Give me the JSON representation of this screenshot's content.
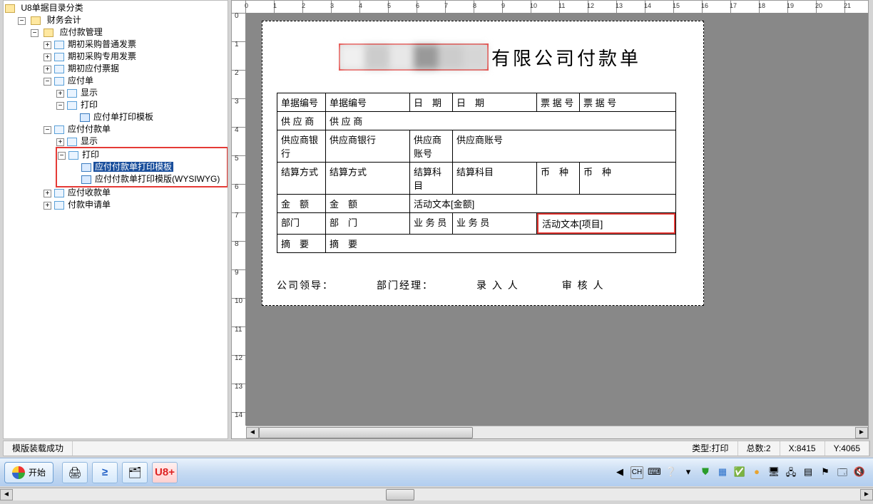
{
  "tree": {
    "root": "U8单据目录分类",
    "n_1": "财务会计",
    "n_1_1": "应付款管理",
    "n_1_1_1": "期初采购普通发票",
    "n_1_1_2": "期初采购专用发票",
    "n_1_1_3": "期初应付票据",
    "n_1_1_4": "应付单",
    "n_1_1_4_1": "显示",
    "n_1_1_4_2": "打印",
    "n_1_1_4_2_1": "应付单打印模板",
    "n_1_1_5": "应付付款单",
    "n_1_1_5_1": "显示",
    "n_1_1_5_2": "打印",
    "n_1_1_5_2_1": "应付付款单打印模板",
    "n_1_1_5_2_2": "应付付款单打印模版(WYSIWYG)",
    "n_1_1_6": "应付收款单",
    "n_1_1_7": "付款申请单"
  },
  "title_suffix": "有限公司付款单",
  "form": {
    "r1c1_lab": "单据编号",
    "r1c1_val": "单据编号",
    "r1c2_lab": "日　期",
    "r1c2_val": "日　期",
    "r1c3_lab": "票 据 号",
    "r1c3_val": "票 据 号",
    "r2c1_lab": "供 应 商",
    "r2c1_val": "供 应 商",
    "r3c1_lab": "供应商银行",
    "r3c1_val": "供应商银行",
    "r3c2_lab": "供应商账号",
    "r3c2_val": "供应商账号",
    "r4c1_lab": "结算方式",
    "r4c1_val": "结算方式",
    "r4c2_lab": "结算科目",
    "r4c2_val": "结算科目",
    "r4c3_lab": "币　种",
    "r4c3_val": "币　种",
    "r5c1_lab": "金　额",
    "r5c1_val": "金　额",
    "r5c2_val": "活动文本[金额]",
    "r6c1_lab": "部门",
    "r6c1_val": "部　门",
    "r6c2_lab": "业 务 员",
    "r6c2_val": "业 务 员",
    "r6c3_val": "活动文本[项目]",
    "r7c1_lab": "摘　要",
    "r7c1_val": "摘　要"
  },
  "footer": {
    "f1": "公司领导：",
    "f2": "部门经理：",
    "f3": "录 入 人",
    "f4": "审 核 人"
  },
  "ruler_h": [
    "0",
    "1",
    "2",
    "3",
    "4",
    "5",
    "6",
    "7",
    "8",
    "9",
    "10",
    "11",
    "12",
    "13",
    "14",
    "15",
    "16",
    "17",
    "18",
    "19",
    "20",
    "21"
  ],
  "ruler_v": [
    "0",
    "1",
    "2",
    "3",
    "4",
    "5",
    "6",
    "7",
    "8",
    "9",
    "10",
    "11",
    "12",
    "13",
    "14"
  ],
  "status": {
    "msg": "模版装载成功",
    "type_lab": "类型:",
    "type_val": "打印",
    "count_lab": "总数:",
    "count_val": "2",
    "x_lab": "X:",
    "x_val": "8415",
    "y_lab": "Y:",
    "y_val": "4065"
  },
  "taskbar": {
    "start": "开始",
    "u8": "U8+",
    "ch": "CH"
  }
}
